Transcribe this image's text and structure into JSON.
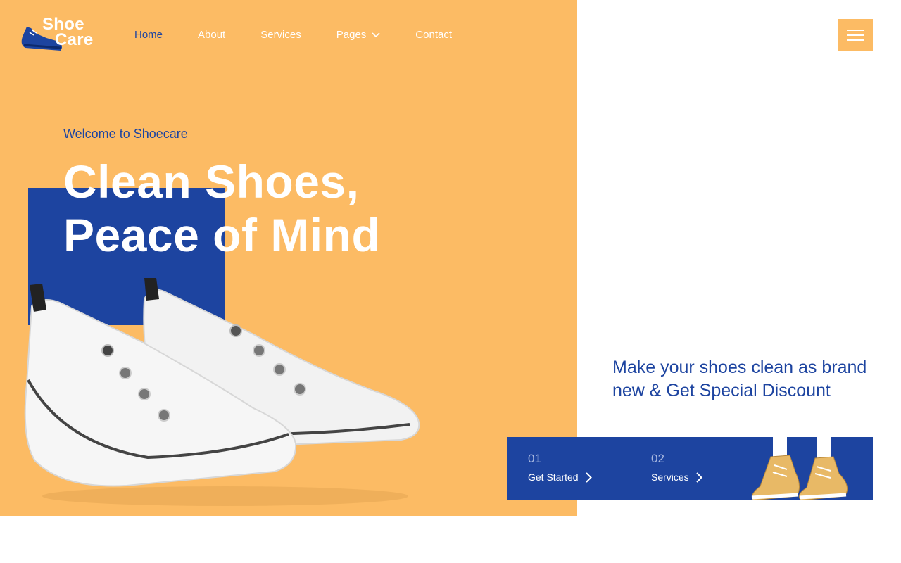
{
  "brand": {
    "line1": "Shoe",
    "line2": "Care",
    "logo_icon": "sneaker-icon"
  },
  "nav": {
    "items": [
      {
        "label": "Home",
        "active": true
      },
      {
        "label": "About"
      },
      {
        "label": "Services"
      },
      {
        "label": "Pages",
        "icon": "chevron-down-icon"
      },
      {
        "label": "Contact"
      }
    ],
    "menu_icon": "hamburger-icon"
  },
  "hero": {
    "eyebrow": "Welcome to Shoecare",
    "headline_line1": "Clean Shoes,",
    "headline_line2": "Peace of Mind"
  },
  "promo": {
    "text": "Make your shoes clean as brand new & Get Special Discount"
  },
  "cta": {
    "steps": [
      {
        "number": "01",
        "label": "Get Started",
        "icon": "chevron-right-icon"
      },
      {
        "number": "02",
        "label": "Services",
        "icon": "chevron-right-icon"
      }
    ]
  },
  "colors": {
    "accent": "#fcbb64",
    "brand_blue": "#1d44a0",
    "text_light": "#ffffff"
  }
}
